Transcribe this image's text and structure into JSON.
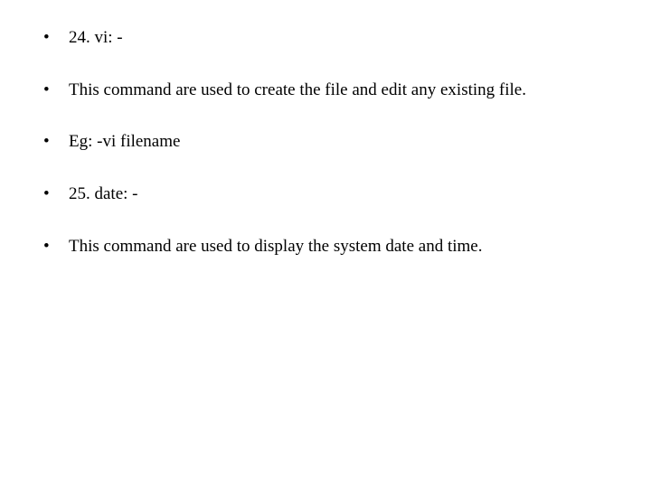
{
  "bullets": [
    "24. vi: -",
    "This command are used to create the file and edit any existing file.",
    "Eg: -vi filename",
    "25. date: -",
    "This command are used to display the system date and time."
  ]
}
